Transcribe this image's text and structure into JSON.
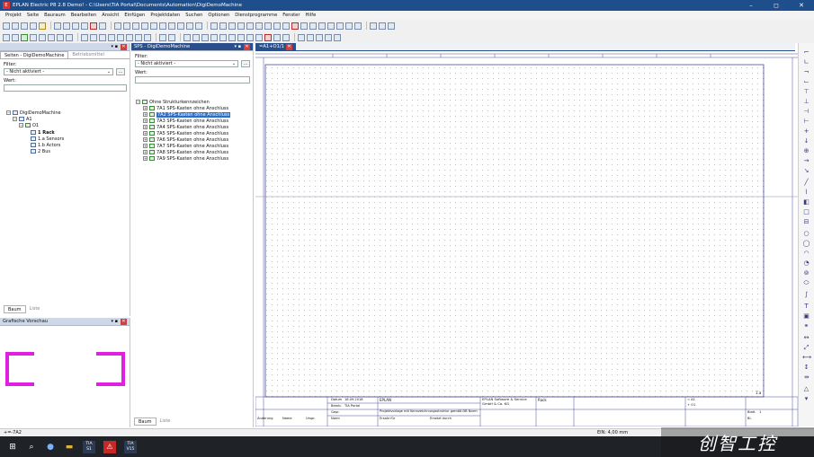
{
  "window": {
    "title": "EPLAN Electric P8 2.8 Demo! - C:\\Users\\TIA Portal\\Documents\\Automation\\DigiDemoMachine",
    "logo_text": "E",
    "minimize": "–",
    "maximize": "◻",
    "close": "✕"
  },
  "menu": [
    "Projekt",
    "Seite",
    "Bauraum",
    "Bearbeiten",
    "Ansicht",
    "Einfügen",
    "Projektdaten",
    "Suchen",
    "Optionen",
    "Dienstprogramme",
    "Fenster",
    "Hilfe"
  ],
  "pages_panel": {
    "title": "",
    "tab_active": "Seiten - DigiDemoMachine",
    "tab_inactive": "Betriebsmittel",
    "filter_label": "Filter:",
    "filter_value": "- Nicht aktiviert -",
    "more_button": "...",
    "value_label": "Wert:",
    "tree": {
      "root": "DigiDemoMachine",
      "a1": "A1",
      "o1": "O1",
      "pages": [
        "1 Rack",
        "1.a Sensors",
        "1.b Actors",
        "2 Bus"
      ]
    },
    "bottom_tab_active": "Baum",
    "bottom_tab_inactive": "Liste"
  },
  "preview_panel": {
    "title": "Grafische Vorschau"
  },
  "sps_panel": {
    "title": "SPS - DigiDemoMachine",
    "filter_label": "Filter:",
    "filter_value": "- Nicht aktiviert -",
    "more_button": "...",
    "value_label": "Wert:",
    "root": "Ohne Strukturkennzeichen",
    "items": [
      "7A1 SPS-Kasten ohne Anschluss",
      "7A2 SPS-Kasten ohne Anschluss",
      "7A3 SPS-Kasten ohne Anschluss",
      "7A4 SPS-Kasten ohne Anschluss",
      "7A5 SPS-Kasten ohne Anschluss",
      "7A6 SPS-Kasten ohne Anschluss",
      "7A7 SPS-Kasten ohne Anschluss",
      "7A8 SPS-Kasten ohne Anschluss",
      "7A9 SPS-Kasten ohne Anschluss"
    ],
    "selected_index": 1,
    "bottom_tab_active": "Baum",
    "bottom_tab_inactive": "Liste"
  },
  "document": {
    "tab_title": "=A1+O1/1",
    "close": "✕",
    "title_block": {
      "company_name": "EPLAN",
      "customer": "EPLAN Software & Service GmbH & Co. KG",
      "description": "Projektvorlage mit Kennzeichnungsstruktur gemäß DB Norm",
      "page_name": "Rack",
      "date_label": "Datum",
      "date_value": "18.09.2018",
      "editor_label": "Bearb.",
      "editor_value": "TIA Portal",
      "check_label": "Gepr.",
      "norm_label": "Norm",
      "change_label": "Änderung",
      "name_label": "Name",
      "orig_label": "Urspr.",
      "replace_label": "Ersatz für",
      "replaced_label": "Ersetzt durch",
      "a1_label": "= A1",
      "o1_label": "+ O1",
      "page_label": "Blatt",
      "page_value": "1",
      "total_label": "Bl.",
      "page_num_marker": "1.a"
    }
  },
  "statusbar": {
    "left": "+=-7A2",
    "right": "EIN: 4,00 mm"
  },
  "taskbar": {
    "start": "⊞",
    "search": "⌕",
    "tia1": "TIA S1",
    "tia2": "TIA V15",
    "eplan": "⚠"
  },
  "watermark": "创智工控",
  "colors": {
    "titlebar": "#1e4e8c",
    "preview_shape": "#e020e0",
    "selection": "#2a6fd0",
    "grid_border": "#4a4a9a"
  }
}
